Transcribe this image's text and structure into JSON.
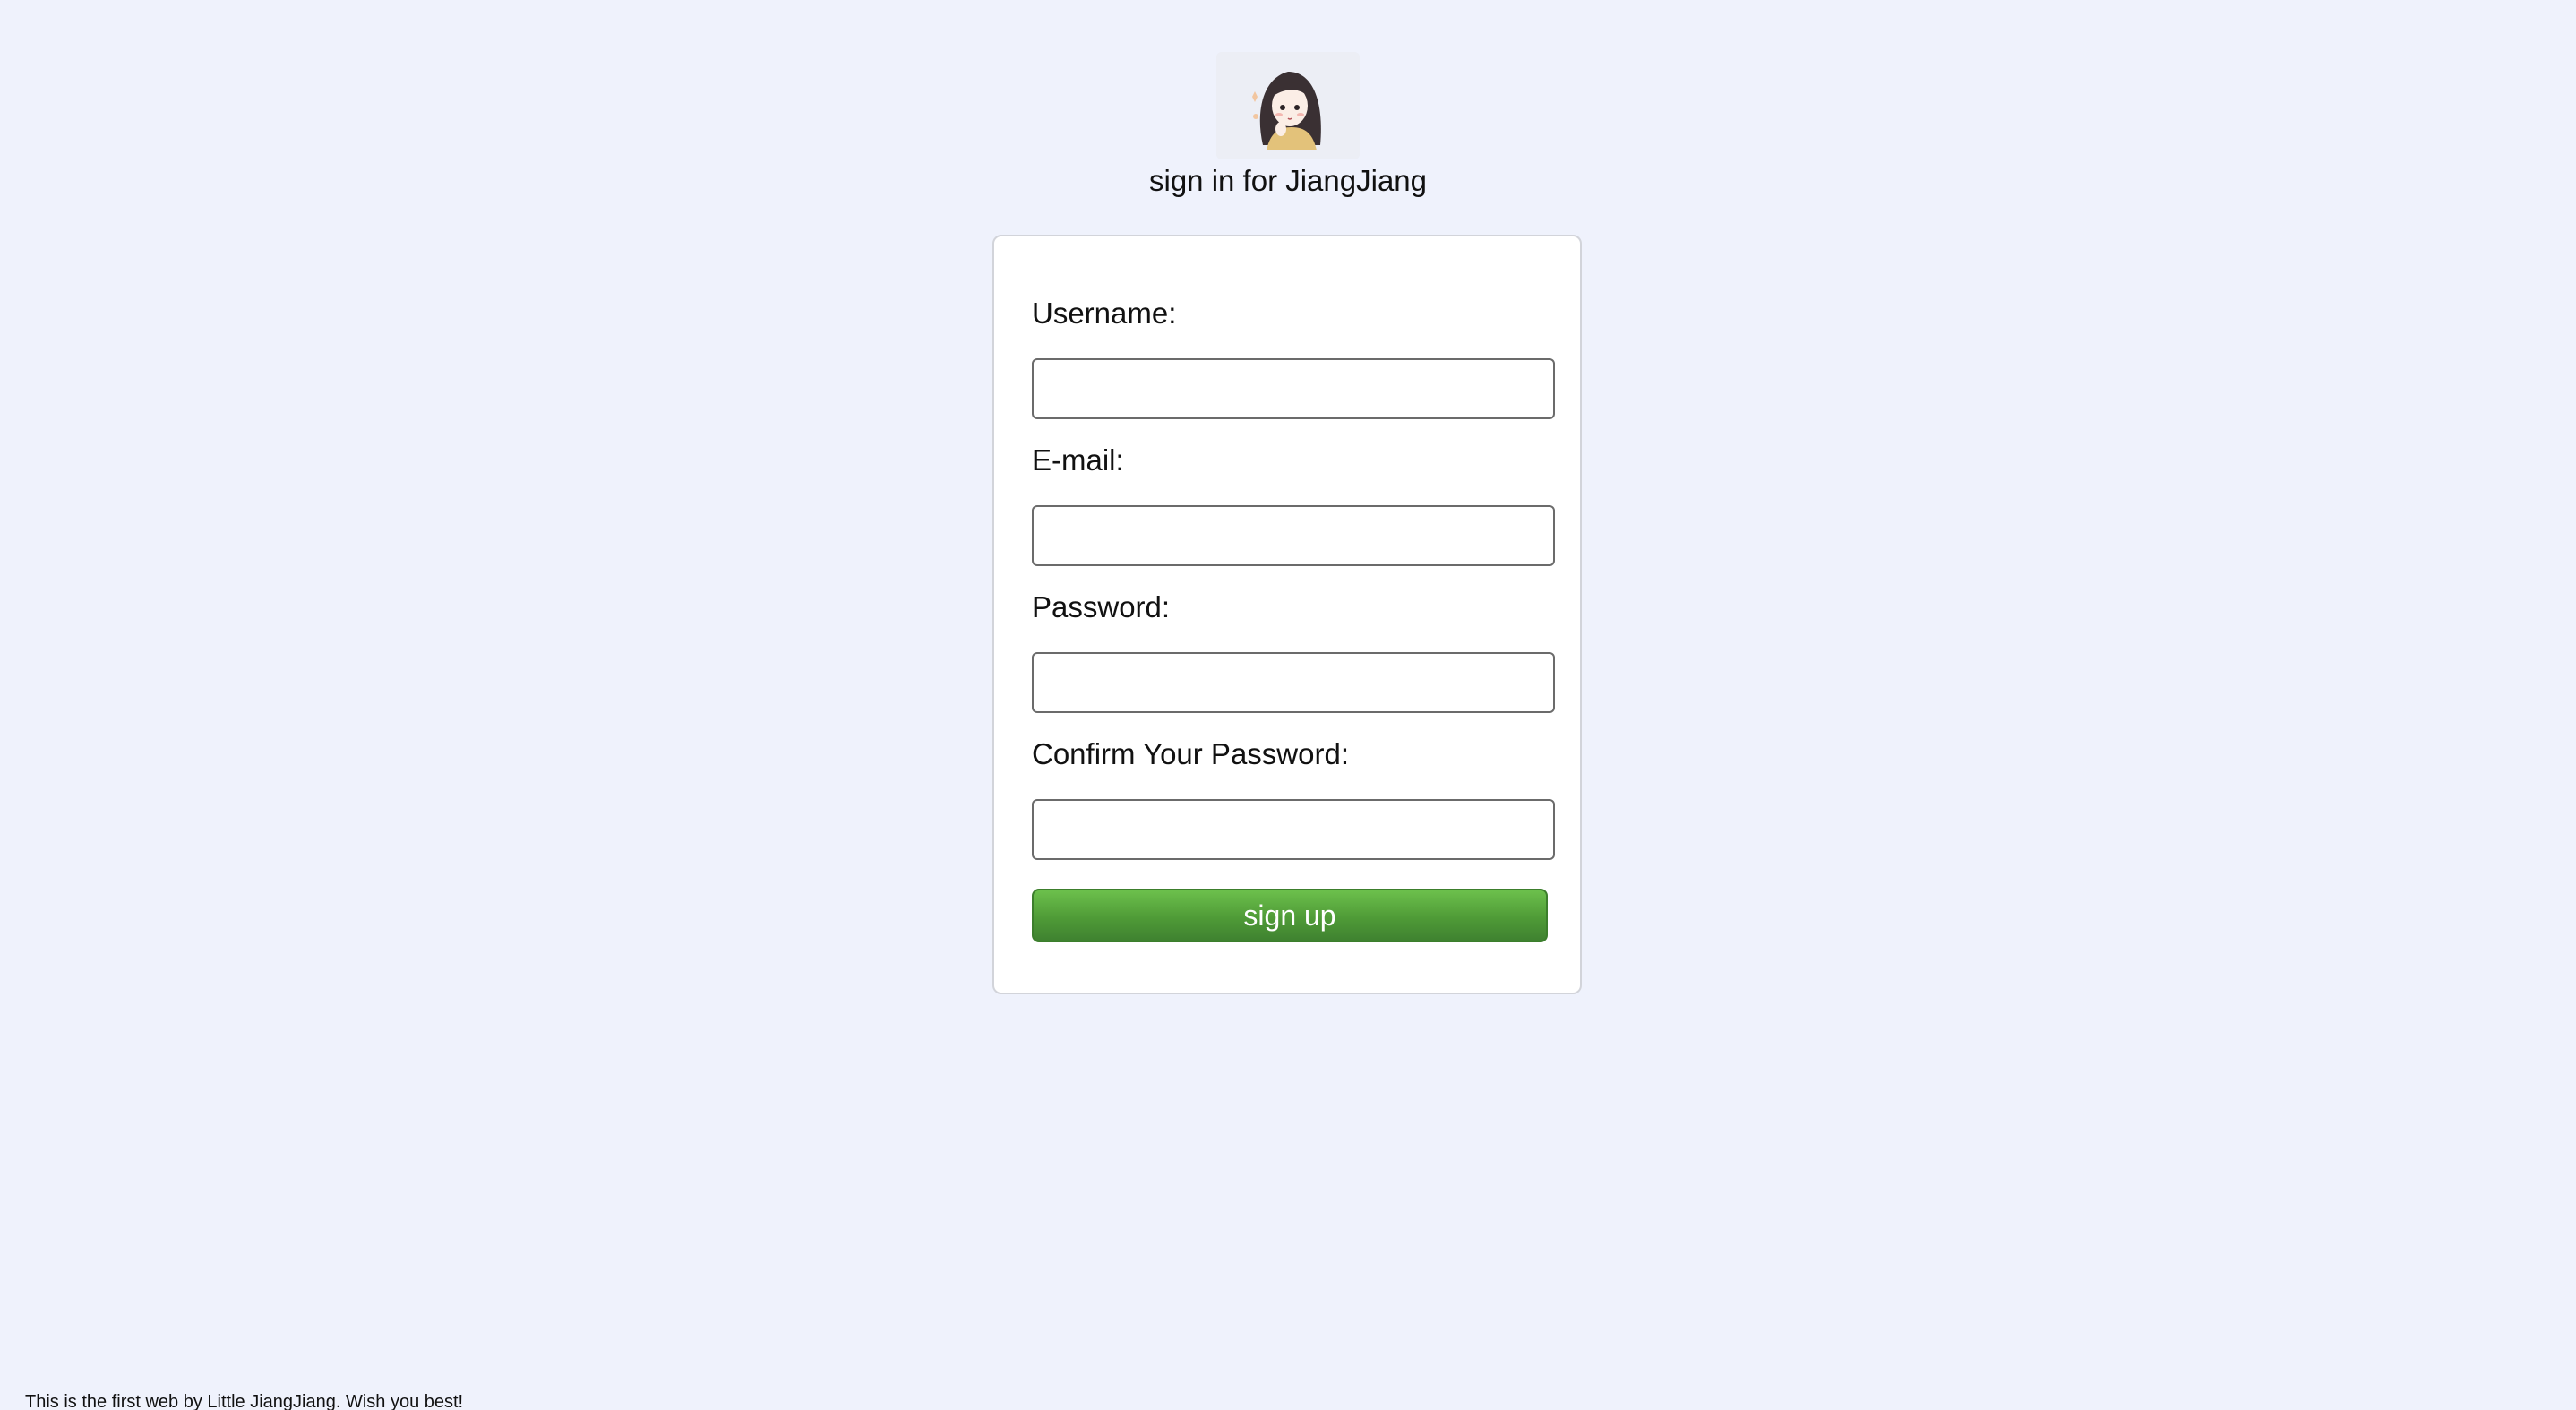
{
  "header": {
    "avatar_icon": "girl-avatar-icon",
    "title": "sign in for JiangJiang"
  },
  "form": {
    "fields": [
      {
        "label": "Username:",
        "value": "",
        "type": "text"
      },
      {
        "label": "E-mail:",
        "value": "",
        "type": "email"
      },
      {
        "label": "Password:",
        "value": "",
        "type": "password"
      },
      {
        "label": "Confirm Your Password:",
        "value": "",
        "type": "password"
      }
    ],
    "submit_label": "sign up"
  },
  "footer": {
    "text": "This is the first web by Little JiangJiang. Wish you best!"
  },
  "colors": {
    "background": "#eff2fc",
    "button_green": "#4f9b37"
  }
}
